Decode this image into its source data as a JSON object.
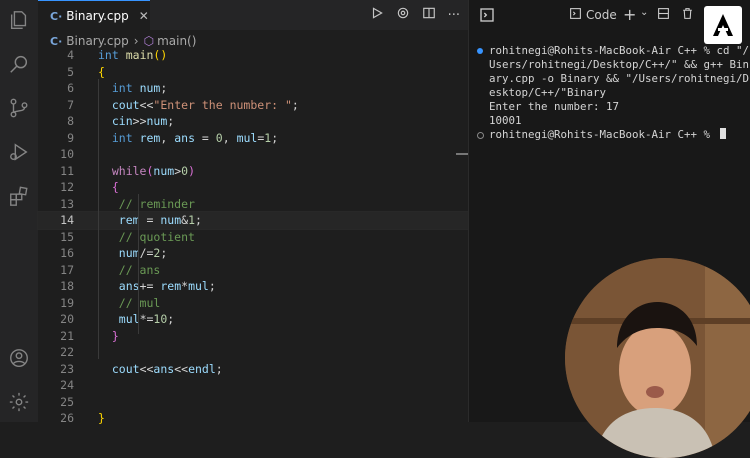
{
  "editor": {
    "tab_label": "Binary.cpp",
    "tab_close": "✕",
    "breadcrumb": {
      "file": "Binary.cpp",
      "symbol": "main()"
    },
    "lines": [
      {
        "n": "4",
        "html": "<span class='kw'>int</span> <span class='fn'>main</span><span class='br'>()</span>"
      },
      {
        "n": "5",
        "html": "<span class='br'>{</span>"
      },
      {
        "n": "6",
        "html": "  <span class='kw'>int</span> <span class='var'>num</span><span class='pl'>;</span>"
      },
      {
        "n": "7",
        "html": "  <span class='var'>cout</span><span class='pl'>&lt;&lt;</span><span class='str'>\"Enter the number: \"</span><span class='pl'>;</span>"
      },
      {
        "n": "8",
        "html": "  <span class='var'>cin</span><span class='pl'>&gt;&gt;</span><span class='var'>num</span><span class='pl'>;</span>"
      },
      {
        "n": "9",
        "html": "  <span class='kw'>int</span> <span class='var'>rem</span><span class='pl'>, </span><span class='var'>ans</span><span class='pl'> = </span><span class='num'>0</span><span class='pl'>, </span><span class='var'>mul</span><span class='pl'>=</span><span class='num'>1</span><span class='pl'>;</span>"
      },
      {
        "n": "10",
        "html": ""
      },
      {
        "n": "11",
        "html": "  <span class='kw2'>while</span><span class='br2'>(</span><span class='var'>num</span><span class='pl'>&gt;</span><span class='num'>0</span><span class='br2'>)</span>"
      },
      {
        "n": "12",
        "html": "  <span class='br2'>{</span>"
      },
      {
        "n": "13",
        "html": "   <span class='cm'>// reminder</span>"
      },
      {
        "n": "14",
        "html": "   <span class='var'>rem</span><span class='pl'> = </span><span class='var'>num</span><span class='pl'>&amp;</span><span class='num'>1</span><span class='pl'>;</span>",
        "current": true
      },
      {
        "n": "15",
        "html": "   <span class='cm'>// quotient</span>"
      },
      {
        "n": "16",
        "html": "   <span class='var'>num</span><span class='pl'>/=</span><span class='num'>2</span><span class='pl'>;</span>"
      },
      {
        "n": "17",
        "html": "   <span class='cm'>// ans</span>"
      },
      {
        "n": "18",
        "html": "   <span class='var'>ans</span><span class='pl'>+= </span><span class='var'>rem</span><span class='pl'>*</span><span class='var'>mul</span><span class='pl'>;</span>"
      },
      {
        "n": "19",
        "html": "   <span class='cm'>// mul</span>"
      },
      {
        "n": "20",
        "html": "   <span class='var'>mul</span><span class='pl'>*=</span><span class='num'>10</span><span class='pl'>;</span>"
      },
      {
        "n": "21",
        "html": "  <span class='br2'>}</span>"
      },
      {
        "n": "22",
        "html": ""
      },
      {
        "n": "23",
        "html": "  <span class='var'>cout</span><span class='pl'>&lt;&lt;</span><span class='var'>ans</span><span class='pl'>&lt;&lt;</span><span class='var'>endl</span><span class='pl'>;</span>"
      },
      {
        "n": "24",
        "html": ""
      },
      {
        "n": "25",
        "html": ""
      },
      {
        "n": "26",
        "html": "<span class='br'>}</span>"
      }
    ]
  },
  "terminal": {
    "header_code_label": "Code",
    "lines": [
      {
        "dot": "blue",
        "text": "rohitnegi@Rohits-MacBook-Air C++ % cd \"/"
      },
      {
        "dot": "",
        "text": "Users/rohitnegi/Desktop/C++/\" && g++ Bin"
      },
      {
        "dot": "",
        "text": "ary.cpp -o Binary && \"/Users/rohitnegi/D"
      },
      {
        "dot": "",
        "text": "esktop/C++/\"Binary"
      },
      {
        "dot": "",
        "text": "Enter the number: 17"
      },
      {
        "dot": "",
        "text": "10001"
      },
      {
        "dot": "hollow",
        "text": "rohitnegi@Rohits-MacBook-Air C++ % ",
        "cursor": true
      }
    ]
  },
  "colors": {
    "accent": "#3794ff",
    "editor_bg": "#1e1e1e",
    "terminal_bg": "#181818"
  },
  "icons": [
    "files-icon",
    "search-icon",
    "source-control-icon",
    "run-debug-icon",
    "extensions-icon",
    "account-icon",
    "settings-gear-icon",
    "run-icon",
    "split-editor-icon",
    "more-icon",
    "terminal-icon",
    "add-icon",
    "chevron-down-icon",
    "layout-icon",
    "trash-icon",
    "logo-icon"
  ]
}
